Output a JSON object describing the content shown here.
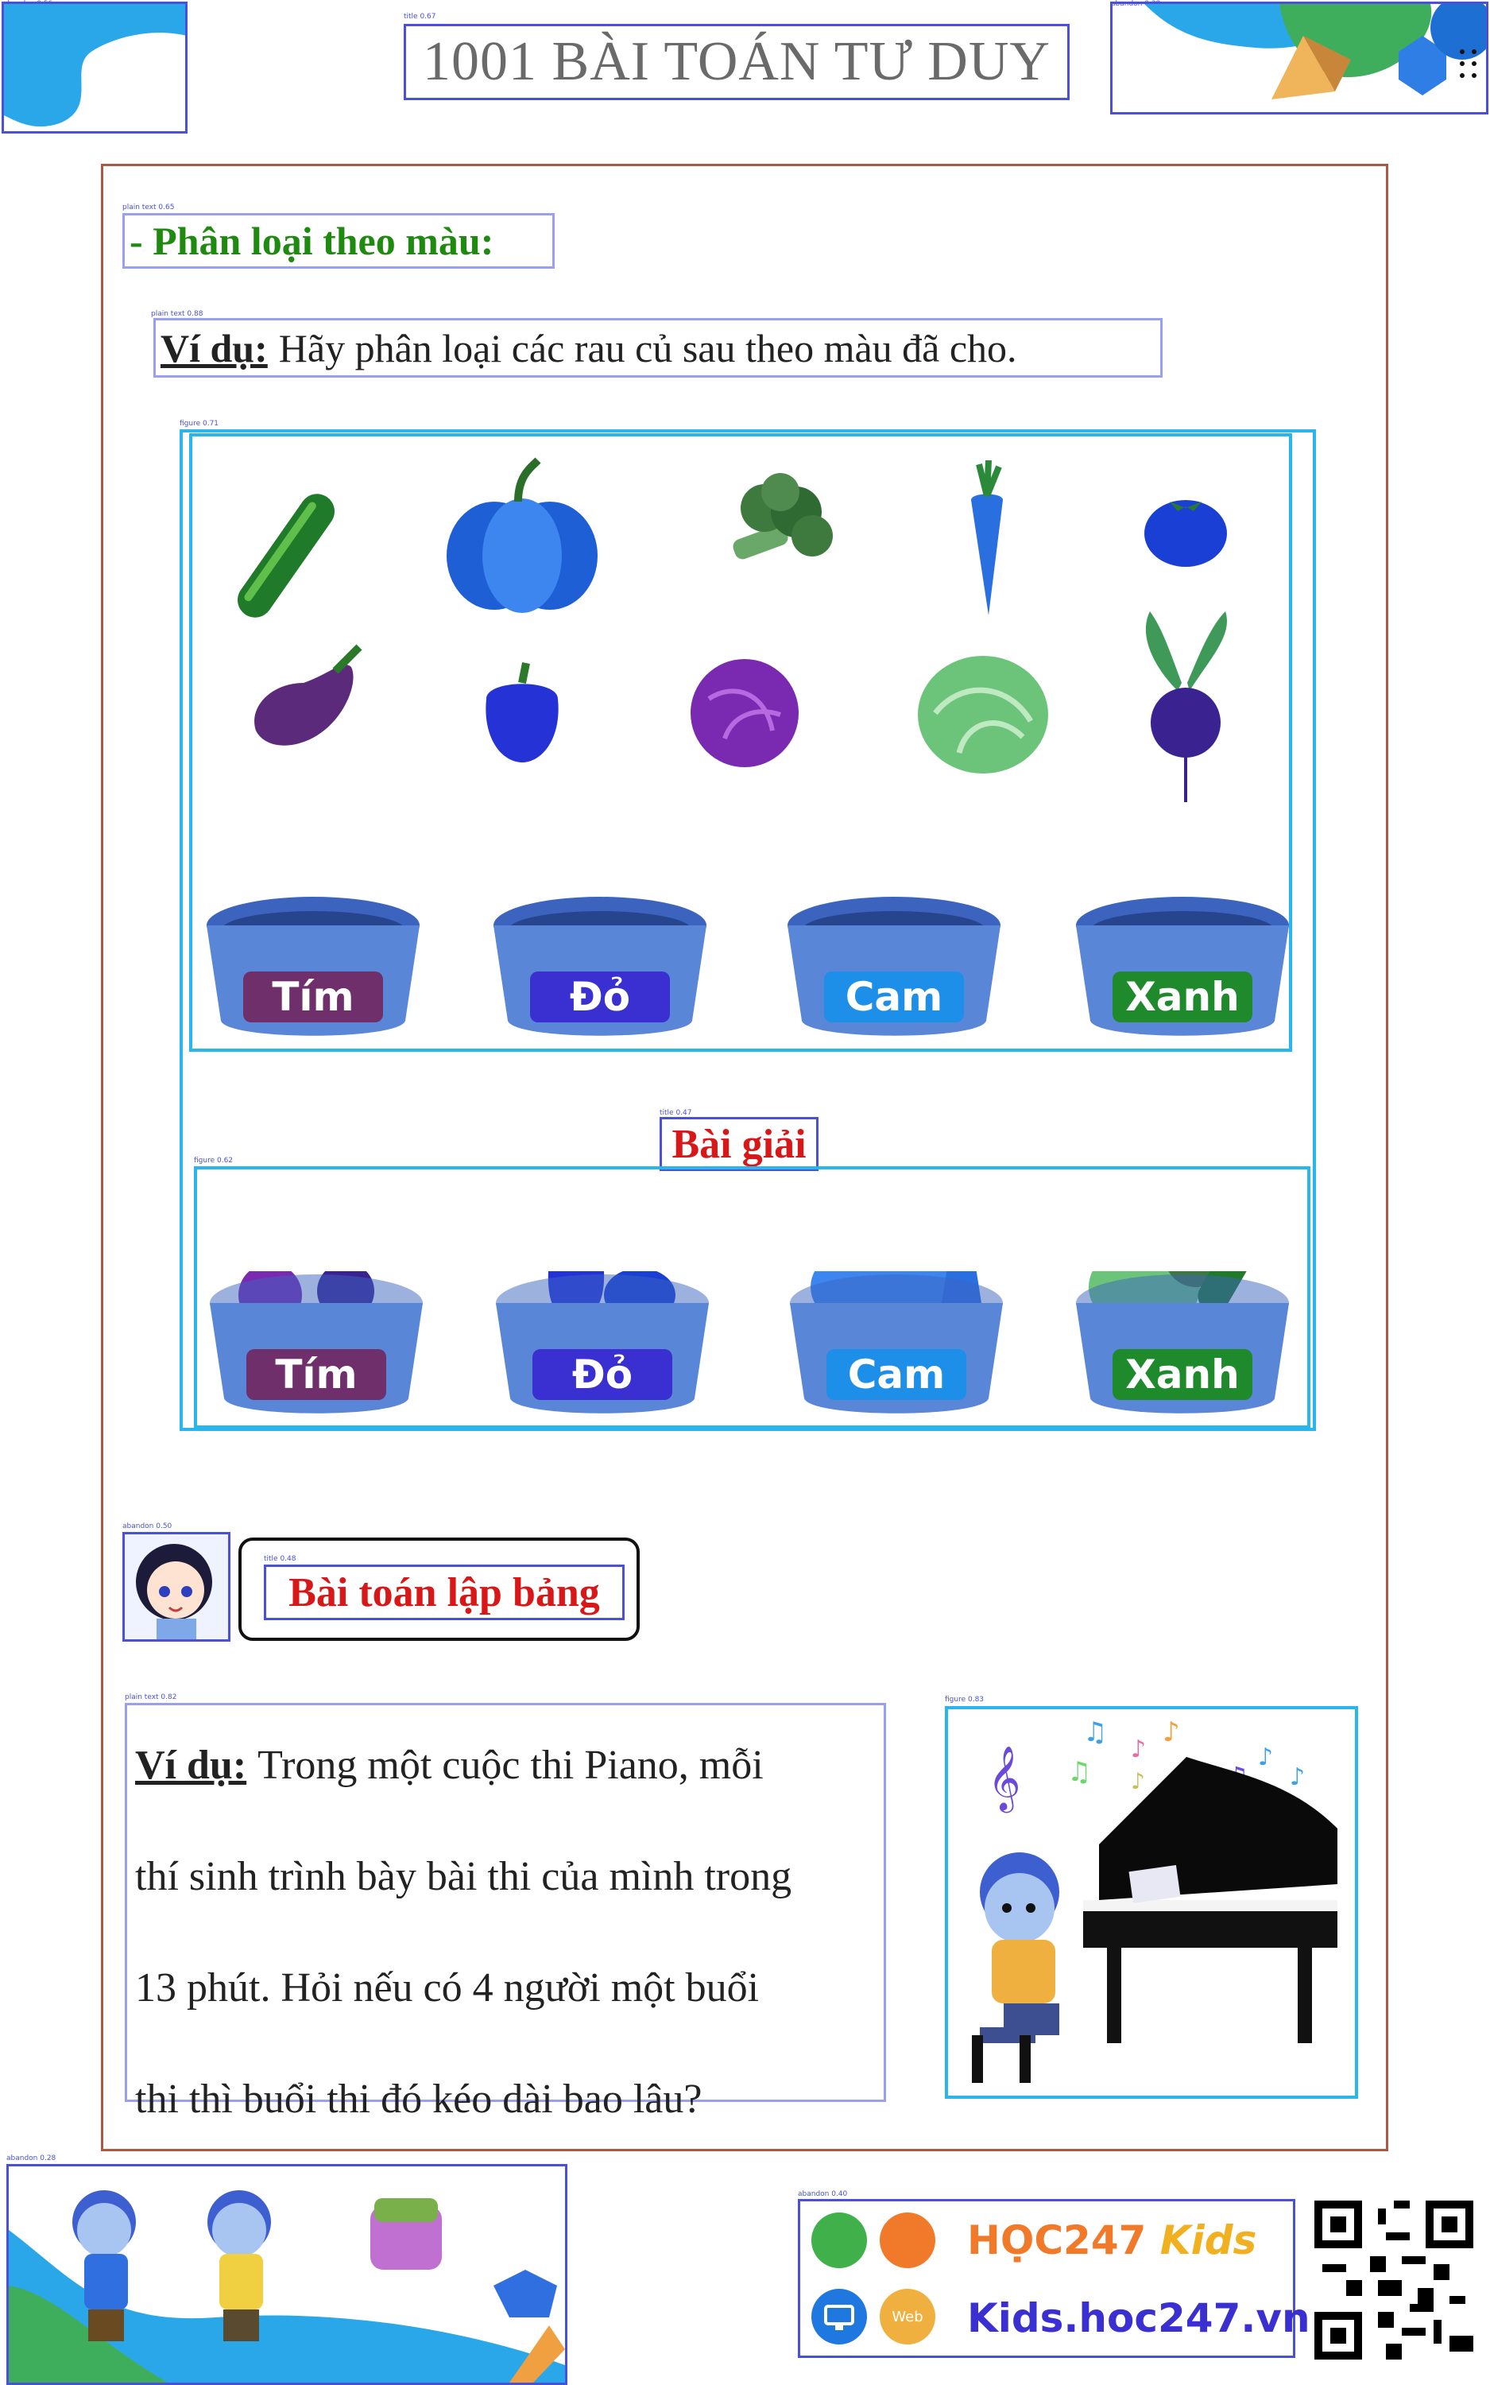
{
  "header": {
    "title": "1001 BÀI TOÁN TƯ DUY"
  },
  "section_color": {
    "heading": "- Phân loại theo màu:",
    "example_label": "Ví dụ:",
    "example_text": "Hãy phân loại các rau củ sau theo màu đã cho.",
    "baskets": [
      "Tím",
      "Đỏ",
      "Cam",
      "Xanh"
    ],
    "solution_title": "Bài giải",
    "solution_baskets": [
      "Tím",
      "Đỏ",
      "Cam",
      "Xanh"
    ]
  },
  "section_table": {
    "heading": "Bài toán lập bảng",
    "example_label": "Ví dụ:",
    "lines": [
      "Trong một cuộc thi Piano, mỗi",
      "thí sinh trình bày bài thi của mình trong",
      "13 phút. Hỏi nếu có 4 người một buổi",
      "thi thì buổi thi đó kéo dài bao lâu?"
    ]
  },
  "footer": {
    "brand_name": "HỌC247",
    "brand_kids": "Kids",
    "website": "Kids.hoc247.vn",
    "web_badge": "Web"
  },
  "colors": {
    "blue_veg": "#2e6fe8",
    "basket_blue": "#5a86d8",
    "label_purple": "#6e2f6a",
    "label_red": "#3a2fd0",
    "label_orange": "#1d8fe8",
    "label_green": "#1f8a2c"
  }
}
